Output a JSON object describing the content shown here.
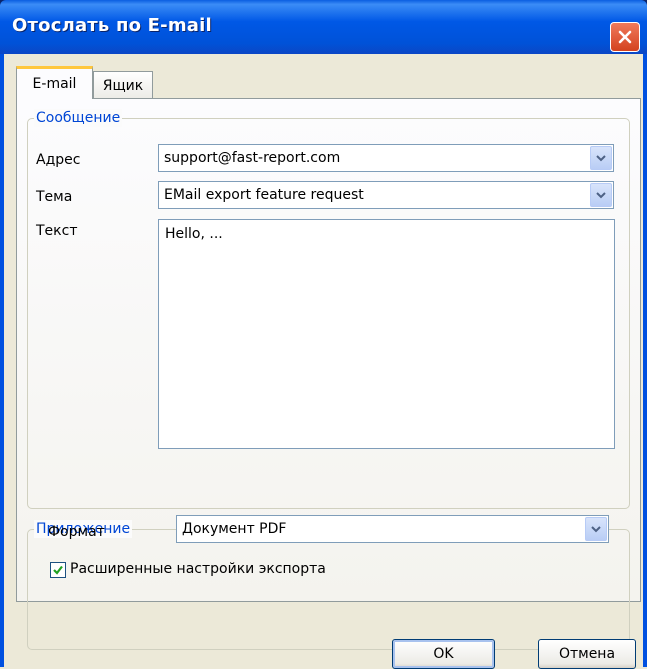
{
  "window": {
    "title": "Отослать по E-mail"
  },
  "tabs": [
    {
      "label": "E-mail",
      "active": true
    },
    {
      "label": "Ящик",
      "active": false
    }
  ],
  "message_group": {
    "legend": "Сообщение",
    "address_label": "Адрес",
    "address_value": "support@fast-report.com",
    "subject_label": "Тема",
    "subject_value": "EMail export feature request",
    "text_label": "Текст",
    "text_value": "Hello, ..."
  },
  "attachment_group": {
    "legend": "Приложение",
    "format_label": "Формат",
    "format_value": "Документ PDF",
    "advanced_checkbox_label": "Расширенные настройки экспорта",
    "advanced_checked": true
  },
  "buttons": {
    "ok": "OK",
    "cancel": "Отмена"
  },
  "colors": {
    "titlebar": "#0058e6",
    "accent_legend": "#0046d5",
    "close_button": "#d3421f"
  }
}
